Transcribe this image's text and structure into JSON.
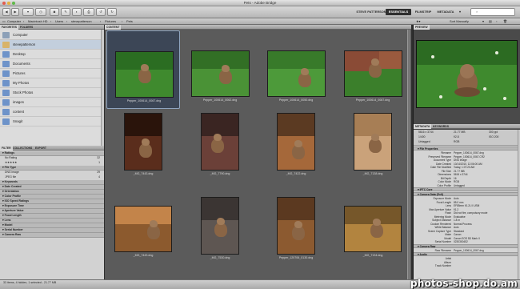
{
  "window": {
    "title": "Pets - Adobe Bridge"
  },
  "workspaces": [
    "STEVE PATTERSON",
    "ESSENTIALS",
    "FILMSTRIP",
    "METADATA"
  ],
  "sort": "Sort Manually",
  "path": [
    "Computer",
    "Macintosh HD",
    "Users",
    "stevepatterson",
    "Pictures",
    "Pets"
  ],
  "left": {
    "tabs": [
      "FAVORITES",
      "FOLDERS"
    ],
    "favorites": [
      "Computer",
      "stevepatterson",
      "Desktop",
      "Documents",
      "Pictures",
      "My Photos",
      "Stock Photos",
      "images",
      "content",
      "Snagit"
    ]
  },
  "filter": {
    "tabs": [
      "FILTER",
      "COLLECTIONS",
      "EXPORT"
    ],
    "rows": [
      {
        "t": "hdr",
        "label": "Ratings"
      },
      {
        "t": "item",
        "label": "No Rating",
        "count": "32"
      },
      {
        "t": "item",
        "label": "★★★★★",
        "count": "1"
      },
      {
        "t": "hdr",
        "label": "File Type"
      },
      {
        "t": "item",
        "label": "DNG image",
        "count": "29"
      },
      {
        "t": "item",
        "label": "JPEG file",
        "count": "4"
      },
      {
        "t": "hdr",
        "label": "Keywords"
      },
      {
        "t": "hdr",
        "label": "Date Created"
      },
      {
        "t": "hdr",
        "label": "Orientation"
      },
      {
        "t": "hdr",
        "label": "Color Profile"
      },
      {
        "t": "hdr",
        "label": "ISO Speed Ratings"
      },
      {
        "t": "hdr",
        "label": "Exposure Time"
      },
      {
        "t": "hdr",
        "label": "Aperture Value"
      },
      {
        "t": "hdr",
        "label": "Focal Length"
      },
      {
        "t": "hdr",
        "label": "Lens"
      },
      {
        "t": "hdr",
        "label": "Model"
      },
      {
        "t": "hdr",
        "label": "Serial Number"
      },
      {
        "t": "hdr",
        "label": "Camera Raw"
      }
    ]
  },
  "content": {
    "tab": "CONTENT",
    "rows": [
      [
        "Pepper_100614_0067.dng",
        "Pepper_100614_0062.dng",
        "Pepper_100614_0050.dng",
        "Pepper_100614_0087.dng"
      ],
      [
        "_MG_7443.dng",
        "_MG_7790.dng",
        "_MG_7422.dng",
        "_MG_7138.dng"
      ],
      [
        "_MG_7443.dng",
        "_MG_7530.dng",
        "Pepper_120706_0130.dng",
        "_MG_7134.dng"
      ]
    ]
  },
  "preview": {
    "tab": "PREVIEW"
  },
  "metadata": {
    "tabs": [
      "METADATA",
      "KEYWORDS"
    ],
    "summary": [
      [
        "5616 x 3744",
        "21.77 MB",
        "300 ppi"
      ],
      [
        "1/400",
        "f/2.8",
        "ISO 200"
      ],
      [
        "Untagged",
        "RGB",
        ""
      ]
    ],
    "sections": [
      {
        "name": "File Properties",
        "rows": [
          [
            "Filename",
            "Pepper_100614_0067.dng"
          ],
          [
            "Preserved Filename",
            "Pepper_100614_0067.CR2"
          ],
          [
            "Document Type",
            "DNG image"
          ],
          [
            "Date Created",
            "10/14/2010, 12:06:00 AM"
          ],
          [
            "Date File Modified",
            "Today, 1:07:20 AM"
          ],
          [
            "File Size",
            "21.77 MB"
          ],
          [
            "Dimensions",
            "5616 x 3744"
          ],
          [
            "Bit Depth",
            "16"
          ],
          [
            "Color Mode",
            "RGB"
          ],
          [
            "Color Profile",
            "Untagged"
          ]
        ]
      },
      {
        "name": "IPTC Core",
        "rows": []
      },
      {
        "name": "Camera Data (Exif)",
        "rows": [
          [
            "Exposure Mode",
            "Auto"
          ],
          [
            "Focal Length",
            "85.0 mm"
          ],
          [
            "Lens",
            "EF85mm f/1.2L II USM"
          ],
          [
            "Max Aperture Value",
            "f/1.2"
          ],
          [
            "Flash",
            "Did not fire, compulsory mode"
          ],
          [
            "Metering Mode",
            "Evaluative"
          ],
          [
            "Subject Distance",
            "1.8 m"
          ],
          [
            "Custom Rendered",
            "Normal Process"
          ],
          [
            "White Balance",
            "Auto"
          ],
          [
            "Scene Capture Type",
            "Standard"
          ],
          [
            "Make",
            "Canon"
          ],
          [
            "Model",
            "Canon EOS 5D Mark II"
          ],
          [
            "Serial Number",
            "0230300452"
          ]
        ]
      },
      {
        "name": "Camera Raw",
        "rows": [
          [
            "Raw Filename",
            "Pepper_100614_0067.dng"
          ]
        ]
      },
      {
        "name": "Audio",
        "rows": [
          [
            "Artist",
            ""
          ],
          [
            "Album",
            ""
          ],
          [
            "Track Number",
            ""
          ]
        ]
      }
    ]
  },
  "status": "33 items, 4 hidden, 1 selected - 21.77 MB",
  "watermark": "photos-shop.do.am"
}
